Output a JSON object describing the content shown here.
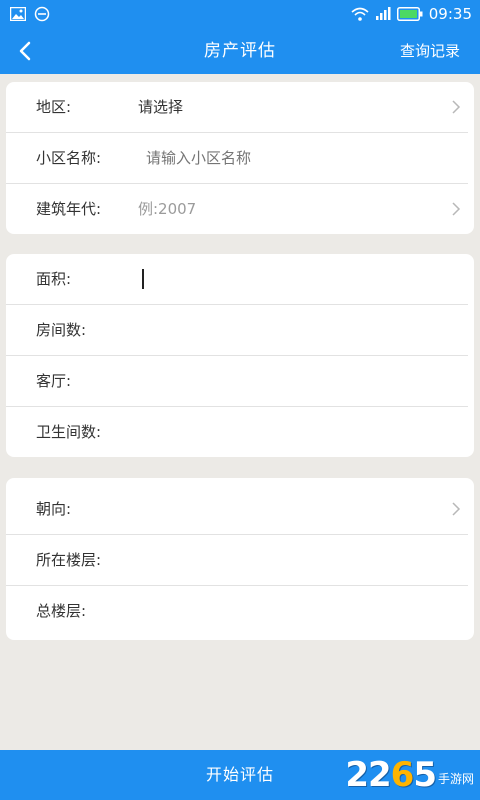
{
  "status": {
    "time": "09:35"
  },
  "header": {
    "title": "房产评估",
    "history": "查询记录"
  },
  "section1": [
    {
      "label": "地区:",
      "value": "请选择",
      "placeholder": false
    },
    {
      "label": "小区名称:",
      "value": "请输入小区名称",
      "placeholder": true
    },
    {
      "label": "建筑年代:",
      "value": "例:2007",
      "placeholder": true
    }
  ],
  "section2": [
    {
      "label": "面积:"
    },
    {
      "label": "房间数:"
    },
    {
      "label": "客厅:"
    },
    {
      "label": "卫生间数:"
    }
  ],
  "section3": [
    {
      "label": "朝向:"
    },
    {
      "label": "所在楼层:"
    },
    {
      "label": "总楼层:"
    }
  ],
  "footer": {
    "start": "开始评估"
  },
  "watermark": {
    "num_a": "22",
    "num_b": "6",
    "num_c": "5",
    "text": "手游网"
  },
  "colors": {
    "primary": "#1f8ff0",
    "background": "#eceae6"
  }
}
